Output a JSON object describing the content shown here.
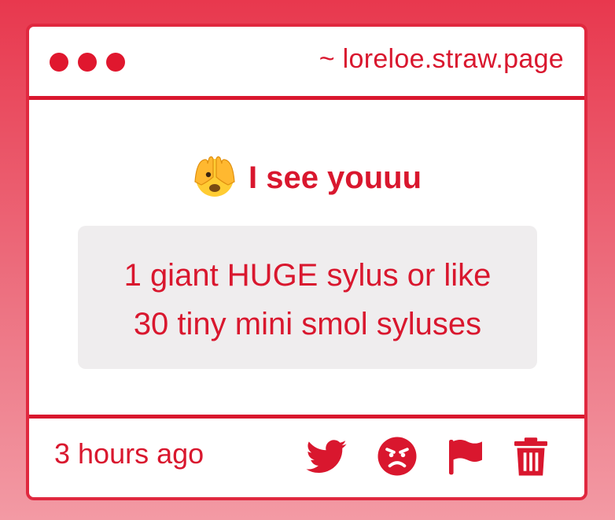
{
  "window": {
    "site": "~ loreloe.straw.page"
  },
  "post": {
    "emoji": "face-with-peeking-eye",
    "title": "I see youuu",
    "body_line1": "1 giant HUGE sylus or like",
    "body_line2": "30 tiny mini smol syluses"
  },
  "footer": {
    "timestamp": "3 hours ago",
    "actions": [
      "twitter-icon",
      "angry-face-icon",
      "flag-icon",
      "trash-icon"
    ]
  },
  "colors": {
    "accent": "#d9172e",
    "background_top": "#e8384e",
    "background_bottom": "#f39aa4",
    "quote_bg": "#efedee"
  }
}
